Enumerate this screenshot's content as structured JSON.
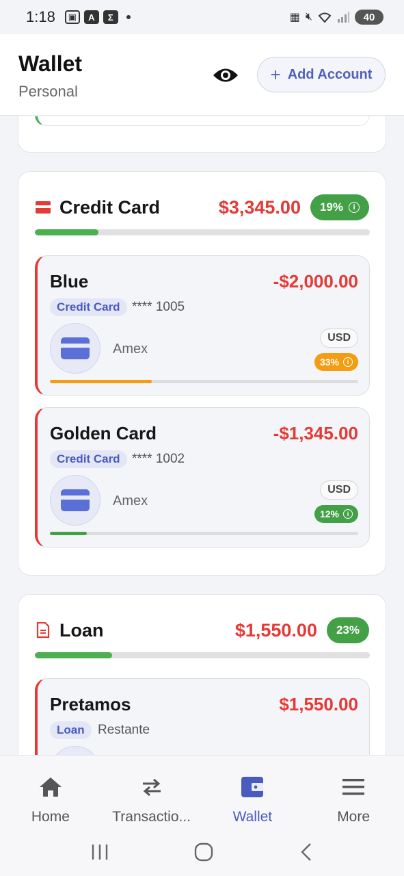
{
  "status_bar": {
    "time": "1:18",
    "icons_left": [
      "screenshot-icon",
      "A",
      "Σ"
    ],
    "battery": "40"
  },
  "header": {
    "title": "Wallet",
    "subtitle": "Personal",
    "add_label": "Add Account"
  },
  "groups": [
    {
      "title": "Credit Card",
      "amount": "$3,345.00",
      "percent": "19%",
      "progress_fraction": 0.19,
      "accounts": [
        {
          "name": "Blue",
          "amount": "-$2,000.00",
          "type": "Credit Card",
          "number": "**** 1005",
          "issuer": "Amex",
          "currency": "USD",
          "percent": "33%",
          "percent_color": "#f29d12",
          "progress_fraction": 0.33
        },
        {
          "name": "Golden Card",
          "amount": "-$1,345.00",
          "type": "Credit Card",
          "number": "**** 1002",
          "issuer": "Amex",
          "currency": "USD",
          "percent": "12%",
          "percent_color": "#43a047",
          "progress_fraction": 0.12
        }
      ]
    },
    {
      "title": "Loan",
      "amount": "$1,550.00",
      "percent": "23%",
      "progress_fraction": 0.23,
      "accounts": [
        {
          "name": "Pretamos",
          "amount": "$1,550.00",
          "type": "Loan",
          "number": "Restante"
        }
      ]
    }
  ],
  "bottom_nav": [
    {
      "label": "Home",
      "icon": "home-icon"
    },
    {
      "label": "Transactio...",
      "icon": "swap-arrows-icon"
    },
    {
      "label": "Wallet",
      "icon": "wallet-icon",
      "active": true
    },
    {
      "label": "More",
      "icon": "menu-icon"
    }
  ],
  "colors": {
    "accent": "#4a5bbf",
    "negative": "#e53935",
    "positive": "#43a047",
    "warning": "#f29d12"
  }
}
